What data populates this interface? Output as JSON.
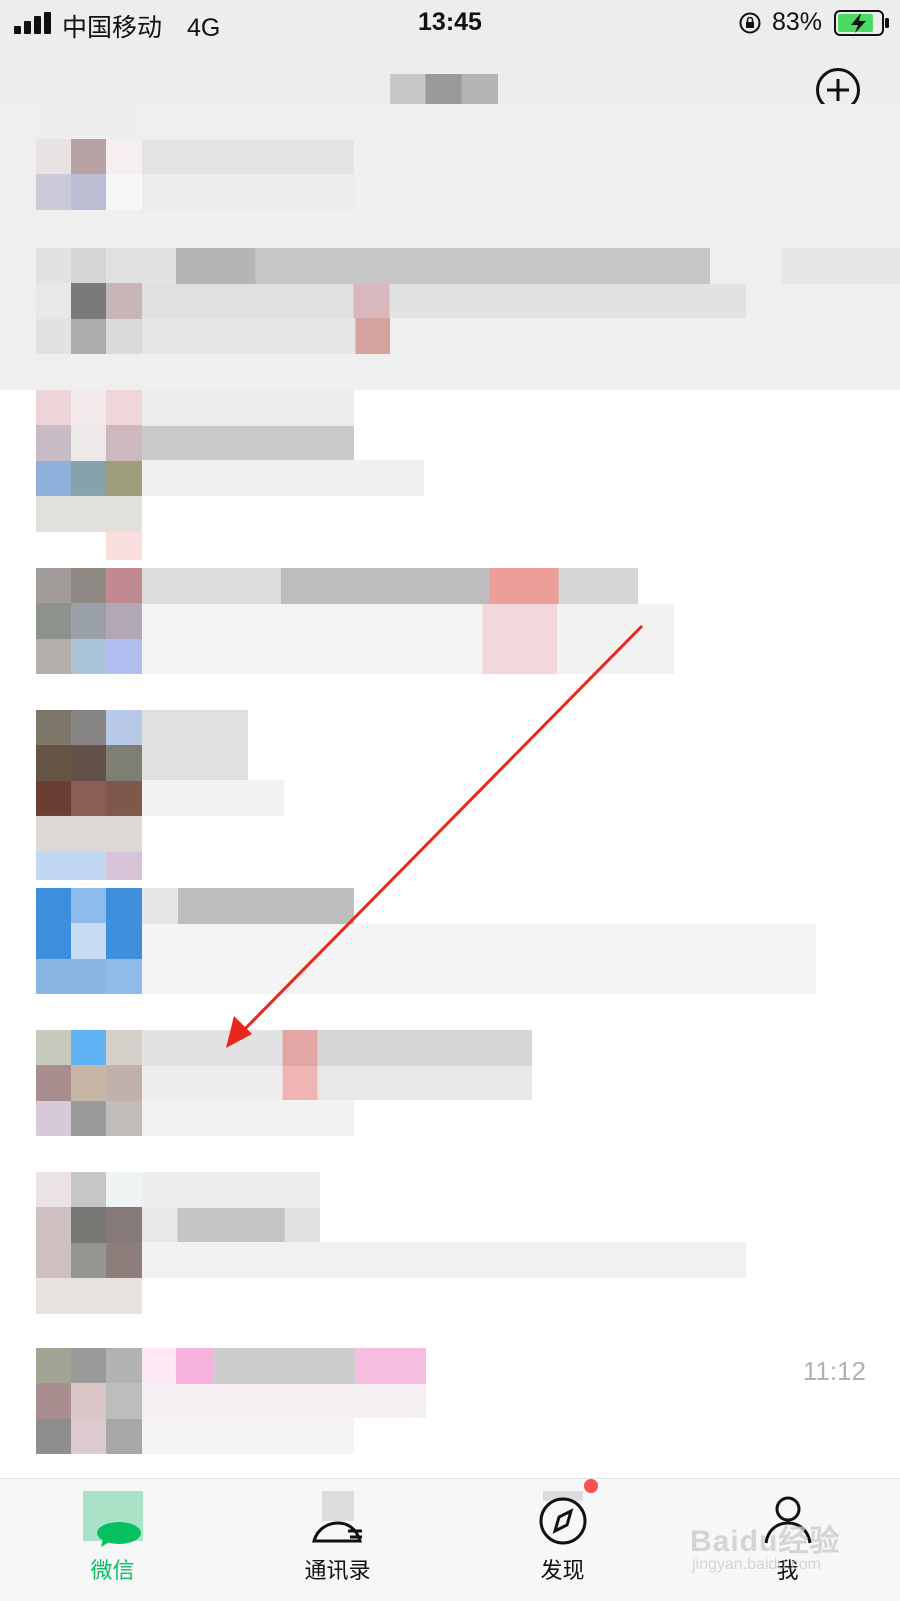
{
  "status_bar": {
    "carrier": "中国移动",
    "network": "4G",
    "time": "13:45",
    "battery_percent": "83%",
    "battery_level": 0.83,
    "charging": true
  },
  "nav": {
    "title_pixelated": true,
    "plus_icon": "plus-circle-icon"
  },
  "chats": [
    {
      "pinned": true,
      "time": ""
    },
    {
      "pinned": true,
      "time": ""
    },
    {
      "pinned": false,
      "time": ""
    },
    {
      "pinned": false,
      "time": ""
    },
    {
      "pinned": false,
      "time": ""
    },
    {
      "pinned": false,
      "time": ""
    },
    {
      "pinned": false,
      "time": ""
    },
    {
      "pinned": false,
      "time": ""
    },
    {
      "pinned": false,
      "time": "11:12"
    }
  ],
  "tabs": [
    {
      "label": "微信",
      "icon": "chat-bubble-icon",
      "active": true
    },
    {
      "label": "通讯录",
      "icon": "contacts-icon",
      "active": false
    },
    {
      "label": "发现",
      "icon": "compass-icon",
      "active": false
    },
    {
      "label": "我",
      "icon": "person-icon",
      "active": false
    }
  ],
  "annotation": {
    "type": "red-arrow",
    "color": "#e8281d"
  },
  "colors": {
    "accent": "#07c160",
    "header_bg": "#ededed",
    "badge": "#fa5151"
  },
  "watermark": {
    "brand": "Baidu经验",
    "site": "jingyan.baidu.com"
  }
}
